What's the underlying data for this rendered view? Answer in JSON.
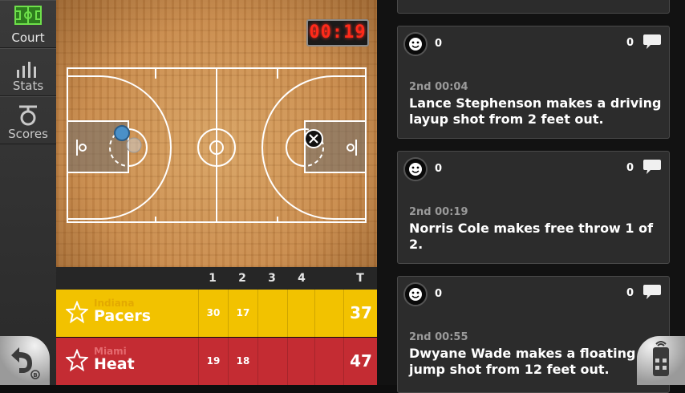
{
  "sidebar": {
    "items": [
      {
        "label": "Court",
        "icon": "court-icon",
        "active": true
      },
      {
        "label": "Stats",
        "icon": "stats-icon"
      },
      {
        "label": "Scores",
        "icon": "scores-icon"
      }
    ]
  },
  "court": {
    "shot_clock": "00:19"
  },
  "scoreboard": {
    "headers": [
      "1",
      "2",
      "3",
      "4",
      "T"
    ],
    "teams": [
      {
        "city": "Indiana",
        "name": "Pacers",
        "quarters": [
          "30",
          "17",
          "",
          ""
        ],
        "total": "37",
        "color": "#f2c200"
      },
      {
        "city": "Miami",
        "name": "Heat",
        "quarters": [
          "19",
          "18",
          "",
          ""
        ],
        "total": "47",
        "color": "#c42c33"
      }
    ]
  },
  "feed": {
    "cards": [
      {
        "likes": "0",
        "comments": "0",
        "time": "2nd 00:04",
        "text": "Lance Stephenson makes a driving layup shot from 2 feet out."
      },
      {
        "likes": "0",
        "comments": "0",
        "time": "2nd 00:19",
        "text": "Norris Cole makes free throw 1 of 2."
      },
      {
        "likes": "0",
        "comments": "0",
        "time": "2nd 00:55",
        "text": "Dwyane Wade makes a floating jump shot from 12 feet out."
      }
    ]
  },
  "colors": {
    "accent_green": "#4cd137",
    "shot_clock_red": "#ff2a1a"
  },
  "buttons": {
    "back_icon": "back-arrow-icon",
    "remote_icon": "remote-icon"
  }
}
